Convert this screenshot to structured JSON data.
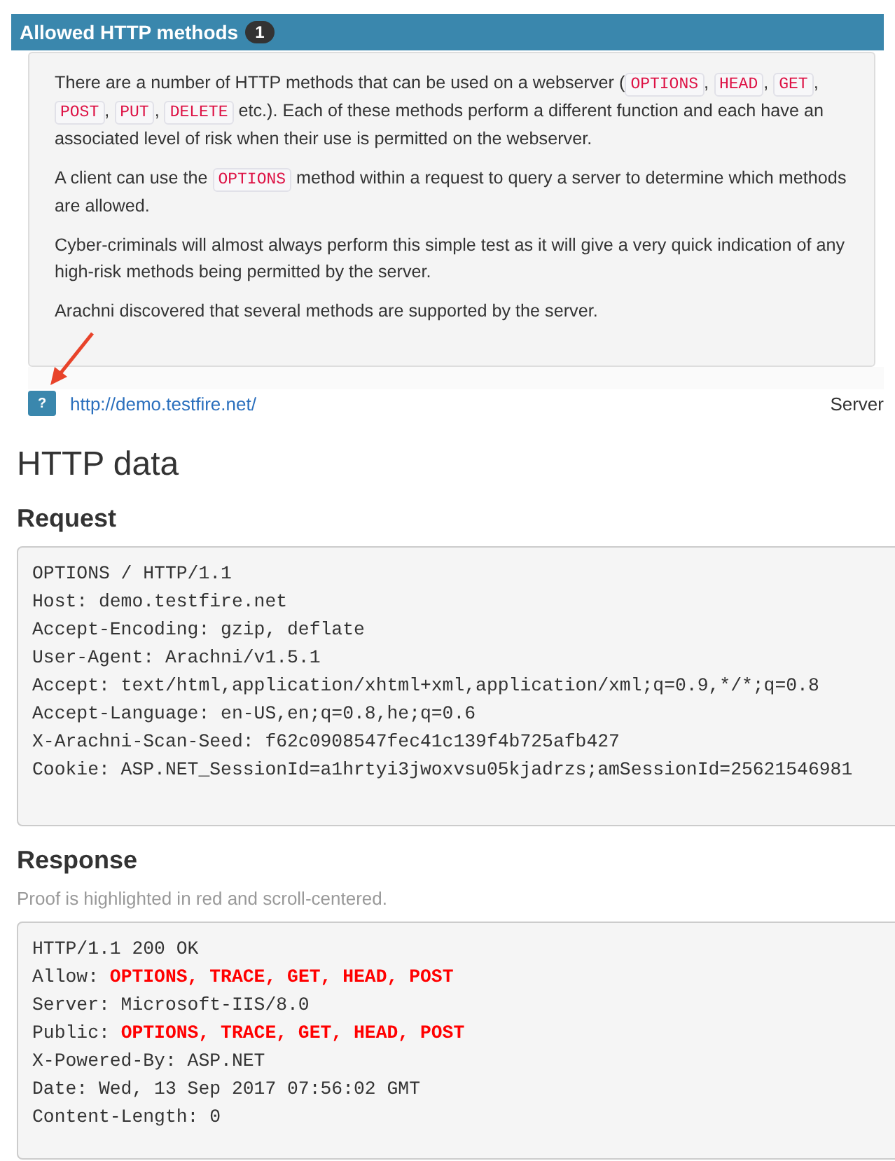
{
  "issue": {
    "title": "Allowed HTTP methods",
    "count": "1",
    "paragraphs": [
      [
        {
          "kind": "text",
          "text": "There are a number of HTTP methods that can be used on a webserver ("
        },
        {
          "kind": "code",
          "text": "OPTIONS"
        },
        {
          "kind": "text",
          "text": ", "
        },
        {
          "kind": "code",
          "text": "HEAD"
        },
        {
          "kind": "text",
          "text": ", "
        },
        {
          "kind": "code",
          "text": "GET"
        },
        {
          "kind": "text",
          "text": ", "
        },
        {
          "kind": "code",
          "text": "POST"
        },
        {
          "kind": "text",
          "text": ", "
        },
        {
          "kind": "code",
          "text": "PUT"
        },
        {
          "kind": "text",
          "text": ", "
        },
        {
          "kind": "code",
          "text": "DELETE"
        },
        {
          "kind": "text",
          "text": " etc.). Each of these methods perform a different function and each have an associated level of risk when their use is permitted on the webserver."
        }
      ],
      [
        {
          "kind": "text",
          "text": "A client can use the "
        },
        {
          "kind": "code",
          "text": "OPTIONS"
        },
        {
          "kind": "text",
          "text": " method within a request to query a server to determine which methods are allowed."
        }
      ],
      [
        {
          "kind": "text",
          "text": "Cyber-criminals will almost always perform this simple test as it will give a very quick indication of any high-risk methods being permitted by the server."
        }
      ],
      [
        {
          "kind": "text",
          "text": "Arachni discovered that several methods are supported by the server."
        }
      ]
    ],
    "help_icon": "?",
    "url": "http://demo.testfire.net/",
    "element": "Server"
  },
  "http_data": {
    "title": "HTTP data",
    "request": {
      "title": "Request",
      "lines": [
        [
          {
            "kind": "plain",
            "text": "OPTIONS / HTTP/1.1"
          }
        ],
        [
          {
            "kind": "plain",
            "text": "Host: demo.testfire.net"
          }
        ],
        [
          {
            "kind": "plain",
            "text": "Accept-Encoding: gzip, deflate"
          }
        ],
        [
          {
            "kind": "plain",
            "text": "User-Agent: Arachni/v1.5.1"
          }
        ],
        [
          {
            "kind": "plain",
            "text": "Accept: text/html,application/xhtml+xml,application/xml;q=0.9,*/*;q=0.8"
          }
        ],
        [
          {
            "kind": "plain",
            "text": "Accept-Language: en-US,en;q=0.8,he;q=0.6"
          }
        ],
        [
          {
            "kind": "plain",
            "text": "X-Arachni-Scan-Seed: f62c0908547fec41c139f4b725afb427"
          }
        ],
        [
          {
            "kind": "plain",
            "text": "Cookie: ASP.NET_SessionId=a1hrtyi3jwoxvsu05kjadrzs;amSessionId=25621546981"
          }
        ]
      ]
    },
    "response": {
      "title": "Response",
      "note": "Proof is highlighted in red and scroll-centered.",
      "lines": [
        [
          {
            "kind": "plain",
            "text": "HTTP/1.1 200 OK"
          }
        ],
        [
          {
            "kind": "plain",
            "text": "Allow: "
          },
          {
            "kind": "proof",
            "text": "OPTIONS, TRACE, GET, HEAD, POST"
          }
        ],
        [
          {
            "kind": "plain",
            "text": "Server: Microsoft-IIS/8.0"
          }
        ],
        [
          {
            "kind": "plain",
            "text": "Public: "
          },
          {
            "kind": "proof",
            "text": "OPTIONS, TRACE, GET, HEAD, POST"
          }
        ],
        [
          {
            "kind": "plain",
            "text": "X-Powered-By: ASP.NET"
          }
        ],
        [
          {
            "kind": "plain",
            "text": "Date: Wed, 13 Sep 2017 07:56:02 GMT"
          }
        ],
        [
          {
            "kind": "plain",
            "text": "Content-Length: 0"
          }
        ]
      ]
    }
  }
}
